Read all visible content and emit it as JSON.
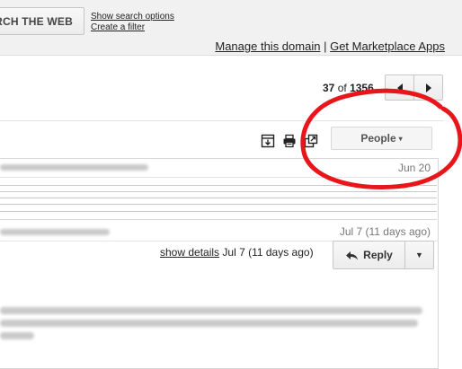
{
  "header": {
    "search_web_label": "RCH THE WEB",
    "show_search_options": "Show search options",
    "create_filter": "Create a filter",
    "manage_domain": "Manage this domain",
    "separator": "|",
    "marketplace": "Get Marketplace Apps"
  },
  "pager": {
    "current": "37",
    "of_label": "of",
    "total": "1356"
  },
  "toolbar": {
    "people_label": "People",
    "people_caret": "▾"
  },
  "thread": {
    "message1_date": "Jun 20",
    "message2_date": "Jul 7 (11 days ago)",
    "show_details": "show details",
    "expanded_date": "Jul 7 (11 days ago)",
    "reply_label": "Reply",
    "reply_more_caret": "▼"
  },
  "colors": {
    "annotation_red": "#e8161b"
  },
  "icons": [
    "archive-icon",
    "print-icon",
    "new-window-icon",
    "reply-arrow-icon",
    "chevron-left-icon",
    "chevron-right-icon"
  ]
}
